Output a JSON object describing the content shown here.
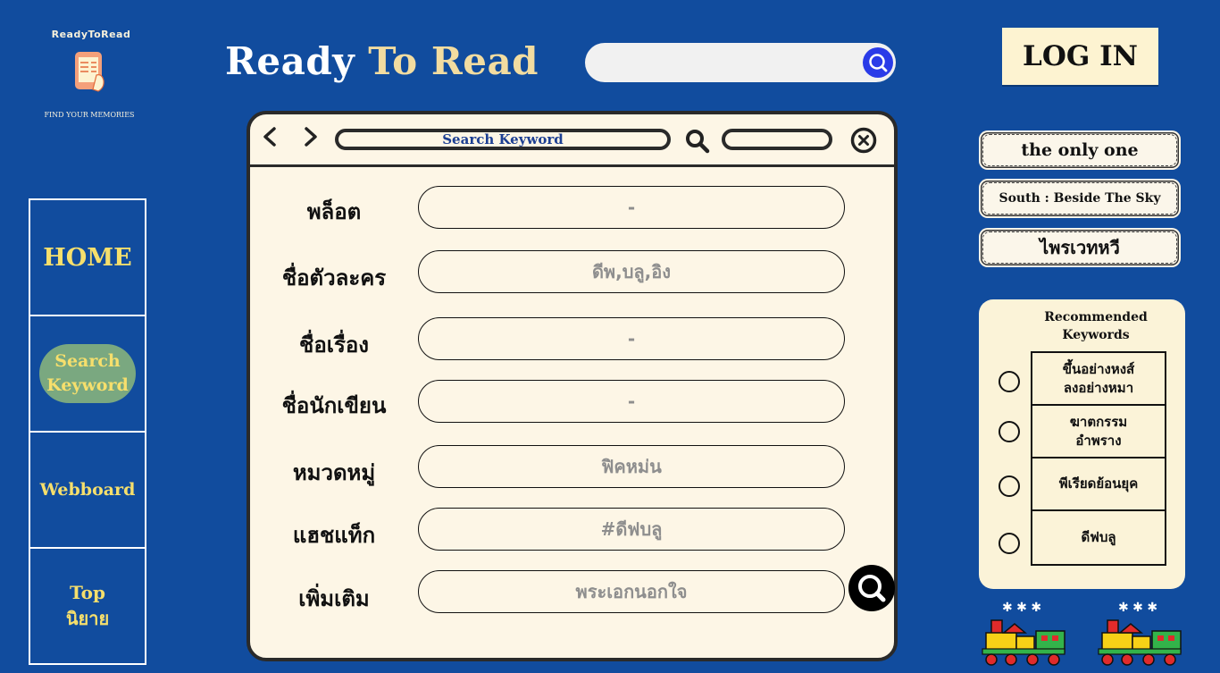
{
  "logo": {
    "top_text": "ReadyToRead",
    "tagline": "FIND YOUR MEMORIES"
  },
  "brand": {
    "part1": "Ready",
    "part2": "To Read"
  },
  "top_search": {
    "value": "",
    "placeholder": ""
  },
  "login_label": "LOG IN",
  "nav": [
    {
      "label": "HOME"
    },
    {
      "label": "Search\nKeyword"
    },
    {
      "label": "Webboard"
    },
    {
      "label": "Top\nนิยาย"
    }
  ],
  "window": {
    "address": "Search Keyword",
    "rows": [
      {
        "label": "พล็อต",
        "value": "-"
      },
      {
        "label": "ชื่อตัวละคร",
        "value": "ดีพ,บลู,อิง"
      },
      {
        "label": "ชื่อเรื่อง",
        "value": "-"
      },
      {
        "label": "ชื่อนักเขียน",
        "value": "-"
      },
      {
        "label": "หมวดหมู่",
        "value": "ฟิคหม่น"
      },
      {
        "label": "แฮชแท็ก",
        "value": "#ดีฟบลู"
      },
      {
        "label": "เพิ่มเติม",
        "value": "พระเอกนอกใจ"
      }
    ]
  },
  "recent": [
    {
      "label": "the only one"
    },
    {
      "label": "South : Beside The Sky"
    },
    {
      "label": "ไพรเวทหวี"
    }
  ],
  "recommended": {
    "title": "Recommended\nKeywords",
    "items": [
      "ขึ้นอย่างหงส์\nลงอย่างหมา",
      "ฆาตกรรม\nอำพราง",
      "พีเรียดย้อนยุค",
      "ดีฟบลู"
    ]
  },
  "icons": {
    "search": "search-icon",
    "back": "chevron-left-icon",
    "forward": "chevron-right-icon",
    "close": "close-icon",
    "train": "toy-train-icon"
  },
  "colors": {
    "background": "#114c9e",
    "accent_yellow": "#f6df6c",
    "panel": "#fdf6e6"
  }
}
